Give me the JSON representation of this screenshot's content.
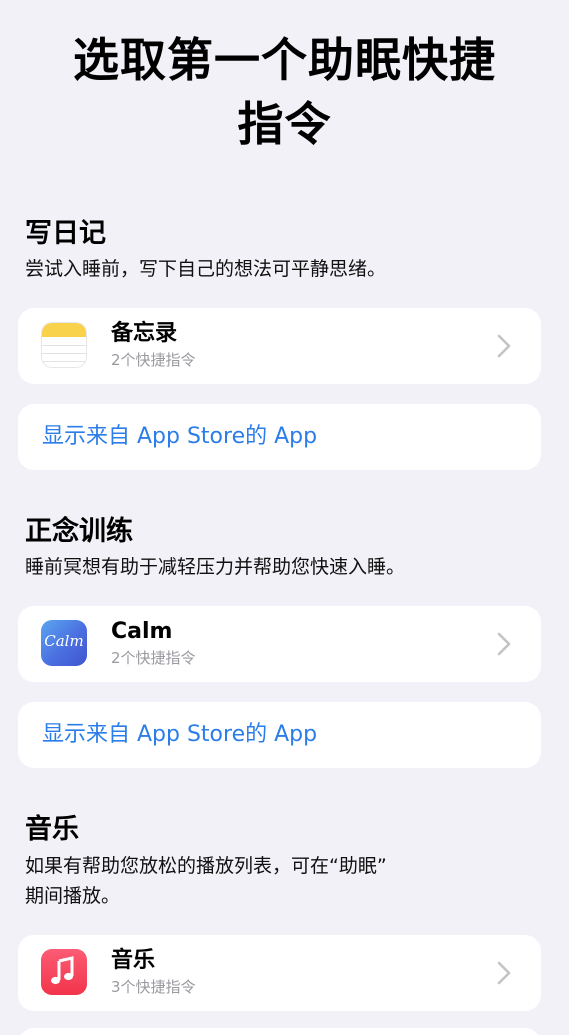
{
  "header": {
    "title_line1": "选取第一个助眠快捷",
    "title_line2": "指令"
  },
  "sections": [
    {
      "title": "写日记",
      "description": "尝试入睡前，写下自己的想法可平静思绪。",
      "app": {
        "name": "备忘录",
        "subtitle": "2个快捷指令",
        "icon": "notes-icon"
      },
      "store_link": "显示来自 App Store的 App"
    },
    {
      "title": "正念训练",
      "description": "睡前冥想有助于减轻压力并帮助您快速入睡。",
      "app": {
        "name": "Calm",
        "subtitle": "2个快捷指令",
        "icon": "calm-icon",
        "icon_text": "Calm"
      },
      "store_link": "显示来自 App Store的 App"
    },
    {
      "title": "音乐",
      "description_line1": "如果有帮助您放松的播放列表，可在“助眠”",
      "description_line2": "期间播放。",
      "app": {
        "name": "音乐",
        "subtitle": "3个快捷指令",
        "icon": "music-icon"
      }
    }
  ],
  "colors": {
    "background": "#f2f1f7",
    "card": "#ffffff",
    "link": "#2b7de9",
    "secondary_text": "#9a9aa0",
    "chevron": "#c4c4c8"
  }
}
